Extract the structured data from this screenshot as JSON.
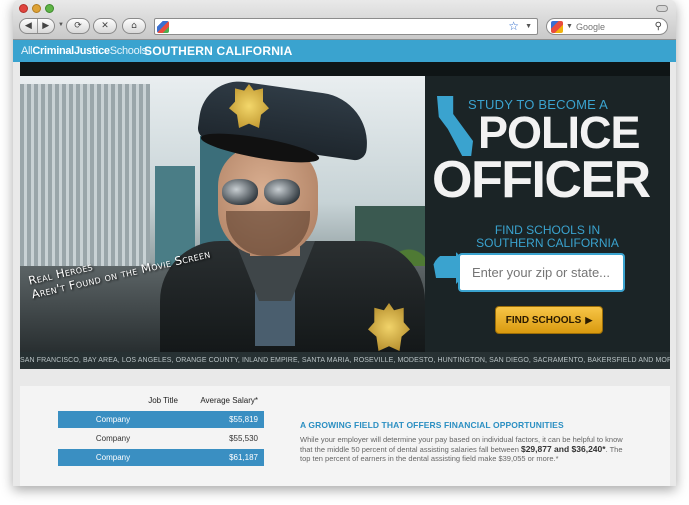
{
  "browser": {
    "url_value": "",
    "search_placeholder": "Google",
    "back_glyph": "◀",
    "forward_glyph": "▶",
    "reload_glyph": "⟳",
    "stop_glyph": "✕",
    "home_glyph": "⌂",
    "star_glyph": "☆",
    "caret_glyph": "▼",
    "magnifier_glyph": "⚲"
  },
  "site": {
    "logo_prefix": "All",
    "logo_bold": "CriminalJustice",
    "logo_suffix": "Schools",
    "region": "SOUTHERN CALIFORNIA",
    "accent_color": "#3aa3cf"
  },
  "hero": {
    "tagline_line1": "Real Heroes",
    "tagline_line2": "Aren't Found on the Movie Screen",
    "study_text": "STUDY TO BECOME A",
    "police_text": "POLICE",
    "officer_text": "OFFICER",
    "find_in_line1": "FIND SCHOOLS IN",
    "find_in_line2": "SOUTHERN CALIFORNIA",
    "zip_placeholder": "Enter your zip or state...",
    "find_button_label": "FIND SCHOOLS",
    "find_button_arrow": "▶",
    "cities": "SAN FRANCISCO, BAY AREA, LOS ANGELES, ORANGE COUNTY, INLAND EMPIRE, SANTA MARIA, ROSEVILLE, MODESTO, HUNTINGTON, SAN DIEGO, SACRAMENTO, BAKERSFIELD AND MORE"
  },
  "salary_table": {
    "col_job": "Job Title",
    "col_salary": "Average Salary*",
    "rows": [
      {
        "job": "Company",
        "salary": "$55,819"
      },
      {
        "job": "Company",
        "salary": "$55,530"
      },
      {
        "job": "Company",
        "salary": "$61,187"
      }
    ]
  },
  "article": {
    "title": "A GROWING FIELD THAT OFFERS FINANCIAL OPPORTUNITIES",
    "body_part1": "While your employer will determine your pay based on individual factors, it can be helpful to know that the middle 50 percent of dental assisting salaries fall between ",
    "bold1": "$29,877 and $36,240*",
    "body_part2": ". The top ten percent of earners in the dental assisting field make $39,055 or more.*"
  }
}
